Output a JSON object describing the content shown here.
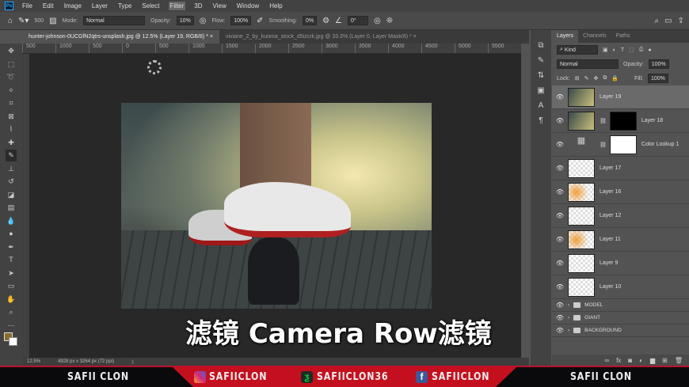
{
  "menu": [
    "File",
    "Edit",
    "Image",
    "Layer",
    "Type",
    "Select",
    "Filter",
    "3D",
    "View",
    "Window",
    "Help"
  ],
  "options": {
    "brush_size": "500",
    "mode_label": "Mode:",
    "mode": "Normal",
    "opacity_label": "Opacity:",
    "opacity": "10%",
    "flow_label": "Flow:",
    "flow": "100%",
    "smoothing_label": "Smoothing:",
    "smoothing": "0%",
    "angle": "0°"
  },
  "tabs": [
    {
      "label": "hunter-johnson-0UCGfN2qtrs-unsplash.jpg @ 12.5% (Layer 19, RGB/8) *",
      "active": true
    },
    {
      "label": "viviane_2_by_kuoma_stock_d5izcrk.jpg @ 33.3% (Layer 0, Layer Mask/8) *",
      "active": false
    }
  ],
  "ruler": [
    "500",
    "1000",
    "500",
    "0",
    "500",
    "1000",
    "1500",
    "2000",
    "2500",
    "3000",
    "3500",
    "4000",
    "4500",
    "5000",
    "5500"
  ],
  "subtitle": "滤镜 Camera Row滤镜",
  "status": {
    "zoom": "12.5%",
    "dimensions": "4928 px x 3264 px (72 ppi)"
  },
  "panel": {
    "tabs": [
      "Layers",
      "Channels",
      "Paths"
    ],
    "filter": "Kind",
    "blend": "Normal",
    "opacity_label": "Opacity:",
    "opacity": "100%",
    "lock_label": "Lock:",
    "fill_label": "Fill:",
    "fill": "100%"
  },
  "layers": [
    {
      "name": "Layer 19",
      "thumb": "photo",
      "selected": true
    },
    {
      "name": "Layer 18",
      "thumb": "photo",
      "mask": "mask"
    },
    {
      "name": "Color Lookup 1",
      "thumb": "adjust",
      "mask": "white"
    },
    {
      "name": "Layer 17",
      "thumb": "empty"
    },
    {
      "name": "Layer 16",
      "thumb": "orange"
    },
    {
      "name": "Layer 12",
      "thumb": "empty"
    },
    {
      "name": "Layer 11",
      "thumb": "orange"
    },
    {
      "name": "Layer 9",
      "thumb": "empty"
    },
    {
      "name": "Layer 10",
      "thumb": "empty"
    }
  ],
  "groups": [
    "MODEL",
    "GIANT",
    "BACKGROUND"
  ],
  "banner": {
    "left": "SAFII CLON",
    "instagram": "SAFIICLON",
    "deviantart": "SAFIICLON36",
    "facebook": "SAFIICLON",
    "right": "SAFII CLON",
    "accent": "#c4101e"
  }
}
